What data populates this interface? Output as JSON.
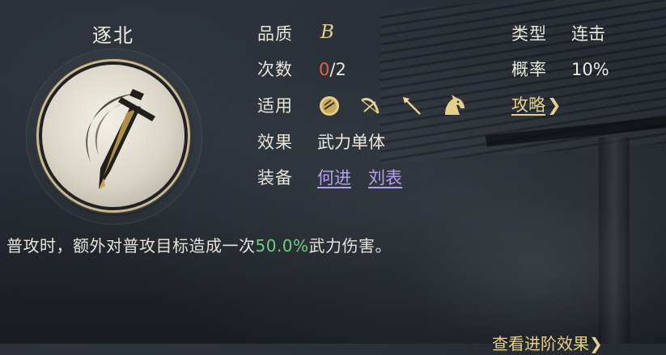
{
  "skill": {
    "name": "逐北"
  },
  "info": {
    "quality_label": "品质",
    "quality_value": "B",
    "uses_label": "次数",
    "uses_current": "0",
    "uses_total": "/2",
    "applies_label": "适用",
    "applies_icons": [
      "shield-icon",
      "bow-icon",
      "spear-icon",
      "cavalry-horse-icon"
    ],
    "effect_label": "效果",
    "effect_value": "武力单体",
    "equip_label": "装备",
    "equip_links": [
      "何进",
      "刘表"
    ],
    "type_label": "类型",
    "type_value": "连击",
    "rate_label": "概率",
    "rate_value": "10%",
    "guide_link": "攻略"
  },
  "description": {
    "prefix": "普攻时，额外对普攻目标造成一次",
    "highlight": "50.0%",
    "suffix": "武力伤害。"
  },
  "footer": {
    "link": "查看进阶效果"
  },
  "colors": {
    "gold": "#e6cf86",
    "red": "#e85d4c",
    "green": "#6fce7a",
    "purple": "#b59ef0"
  }
}
